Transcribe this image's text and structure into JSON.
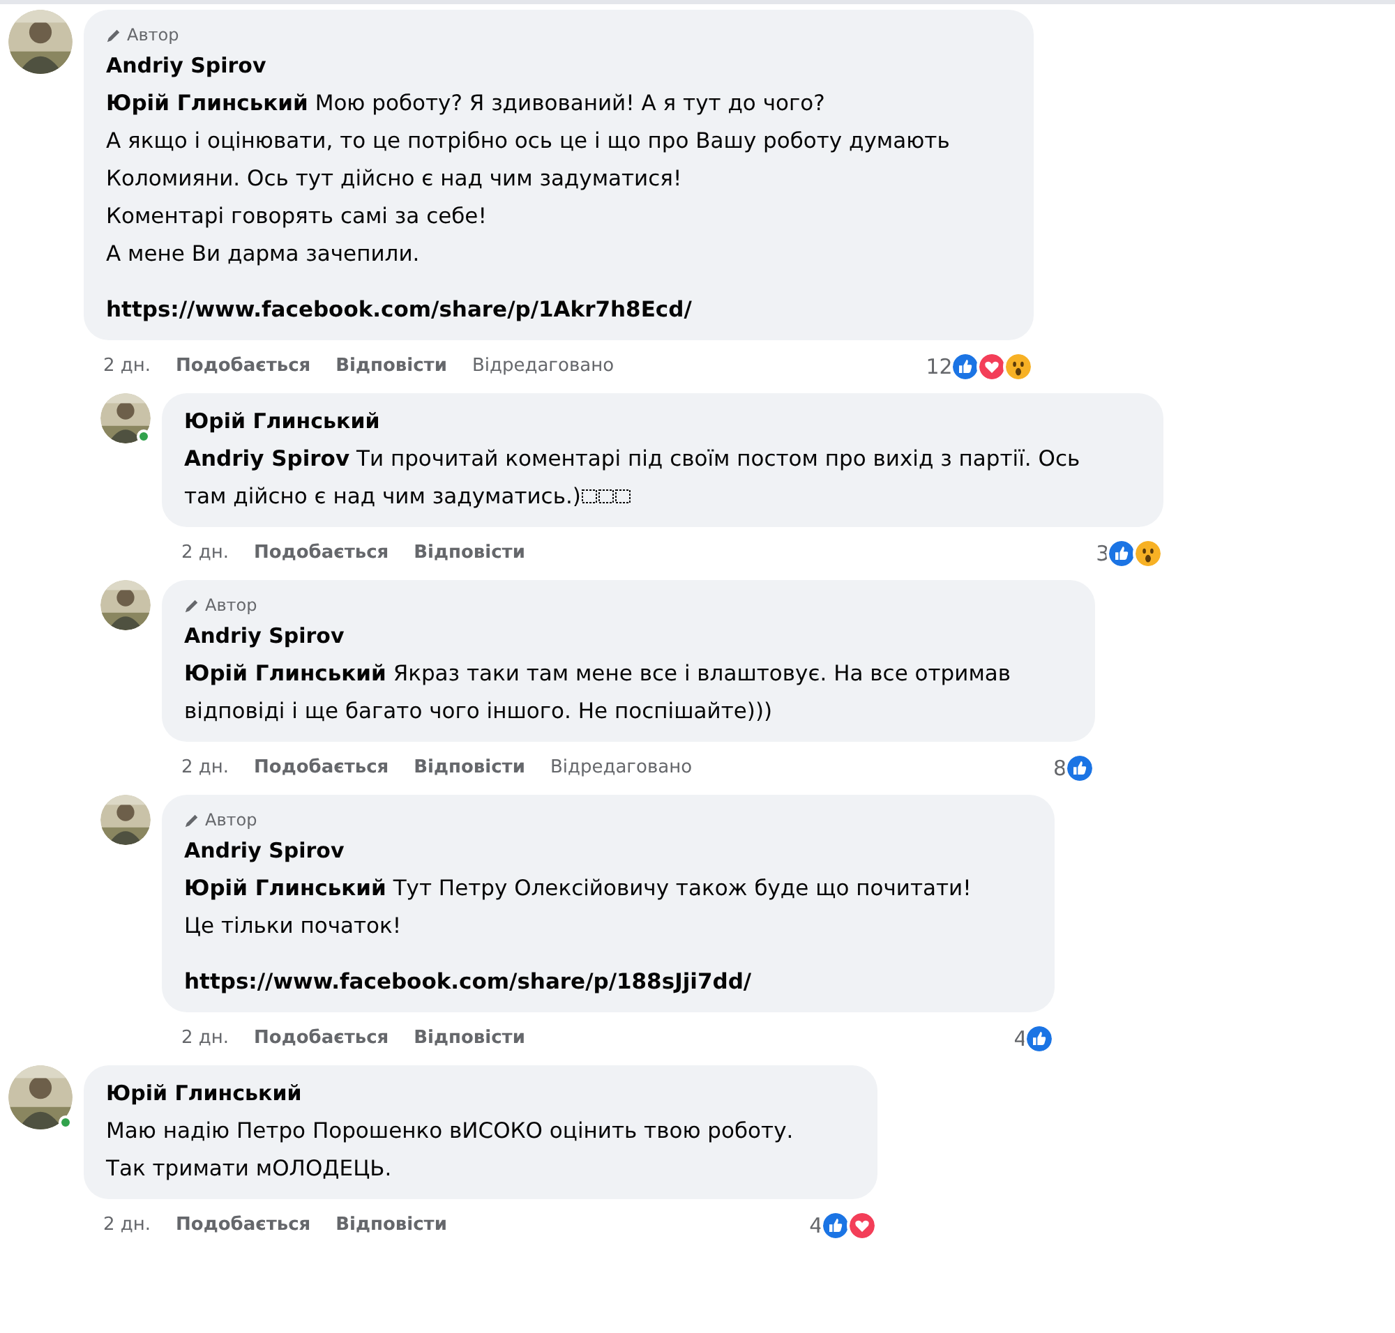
{
  "comments": [
    {
      "author_badge": "Автор",
      "author": "Andriy Spirov",
      "lines": [
        "**Юрій Глинський** Мою роботу? Я здивований! А я тут до чого?",
        "А якщо і оцінювати, то це потрібно ось це і що про Вашу роботу думають",
        "Коломияни. Ось тут дійсно є над чим задуматися!",
        "Коментарі говорять самі за себе!",
        "А мене Ви дарма зачепили."
      ],
      "link": "https://www.facebook.com/share/p/1Akr7h8Ecd/",
      "time": "2 дн.",
      "like_label": "Подобається",
      "reply_label": "Відповісти",
      "edited": "Відредаговано",
      "reaction_count": "12",
      "reactions": [
        {
          "kind": "like"
        },
        {
          "kind": "love"
        },
        {
          "kind": "wow"
        }
      ],
      "children": [
        {
          "author": "Юрій Глинський",
          "online": true,
          "lines": [
            "**Andriy Spirov** Ти прочитай коментарі під своїм постом про вихід з партії. Ось",
            "там дійсно є над чим задуматись.)"
          ],
          "emoji_tail": true,
          "time": "2 дн.",
          "like_label": "Подобається",
          "reply_label": "Відповісти",
          "reaction_count": "3",
          "reactions": [
            {
              "kind": "like"
            },
            {
              "kind": "wow"
            }
          ]
        },
        {
          "author_badge": "Автор",
          "author": "Andriy Spirov",
          "lines": [
            "**Юрій Глинський** Якраз таки там мене все і влаштовує. На все отримав",
            "відповіді і ще багато чого іншого. Не поспішайте)))"
          ],
          "time": "2 дн.",
          "like_label": "Подобається",
          "reply_label": "Відповісти",
          "edited": "Відредаговано",
          "reaction_count": "8",
          "reactions": [
            {
              "kind": "like"
            }
          ]
        },
        {
          "author_badge": "Автор",
          "author": "Andriy Spirov",
          "lines": [
            "**Юрій Глинський** Тут Петру Олексійовичу також буде що почитати!",
            "Це тільки початок!"
          ],
          "link": "https://www.facebook.com/share/p/188sJji7dd/",
          "time": "2 дн.",
          "like_label": "Подобається",
          "reply_label": "Відповісти",
          "reaction_count": "4",
          "reactions": [
            {
              "kind": "like"
            }
          ]
        }
      ]
    },
    {
      "author": "Юрій Глинський",
      "online": true,
      "lines": [
        "Маю надію Петро Порошенко вИСОКО оцінить твою роботу.",
        "Так тримати мОЛОДЕЦЬ."
      ],
      "time": "2 дн.",
      "like_label": "Подобається",
      "reply_label": "Відповісти",
      "reaction_count": "4",
      "reactions": [
        {
          "kind": "like"
        },
        {
          "kind": "love"
        }
      ]
    }
  ]
}
